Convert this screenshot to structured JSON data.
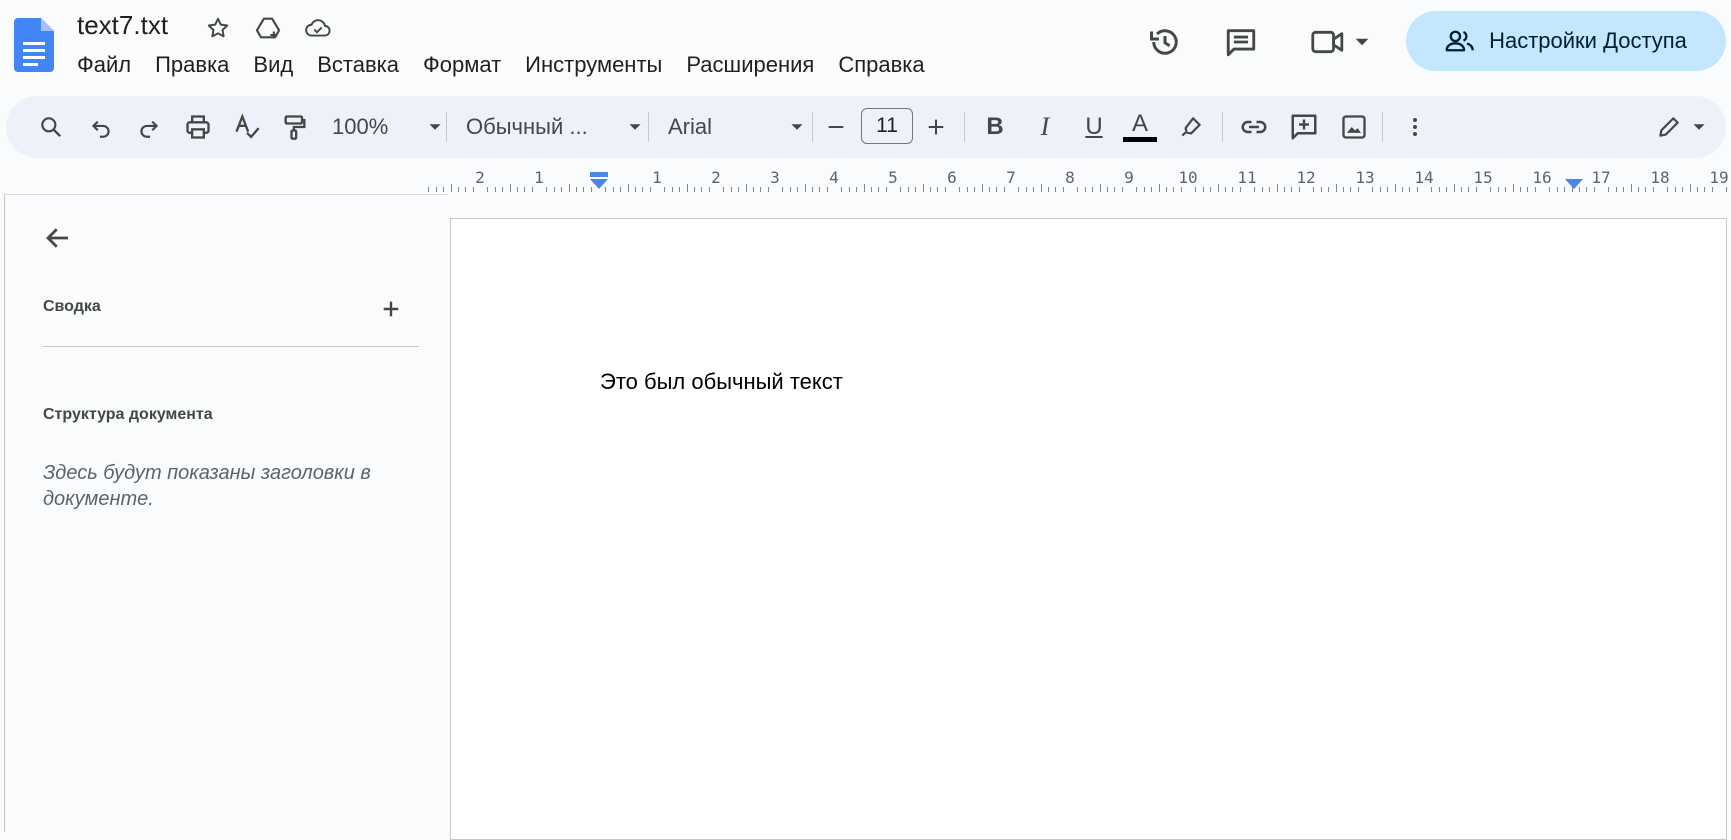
{
  "header": {
    "title": "text7.txt",
    "menu": [
      "Файл",
      "Правка",
      "Вид",
      "Вставка",
      "Формат",
      "Инструменты",
      "Расширения",
      "Справка"
    ],
    "share_label": "Настройки Доступа",
    "icons": {
      "logo": "google-docs-logo",
      "star": "star-icon",
      "move": "move-to-drive-icon",
      "cloud": "cloud-saved-icon",
      "history": "history-icon",
      "comments": "comments-icon",
      "meet": "video-camera-icon",
      "share": "people-icon"
    }
  },
  "toolbar": {
    "zoom": "100%",
    "style": "Обычный ...",
    "font": "Arial",
    "font_size": "11",
    "text_color": "#000000"
  },
  "ruler": {
    "left_numbers": [
      "2",
      "1"
    ],
    "right_numbers": [
      "1",
      "2",
      "3",
      "4",
      "5",
      "6",
      "7",
      "8",
      "9",
      "10",
      "11",
      "12",
      "13",
      "14",
      "15",
      "16",
      "17",
      "18",
      "19"
    ]
  },
  "sidebar": {
    "summary_label": "Сводка",
    "outline_label": "Структура документа",
    "outline_placeholder": "Здесь будут показаны заголовки в документе."
  },
  "document": {
    "text": "Это был обычный текст"
  },
  "colors": {
    "accent": "#1a73e8",
    "share_bg": "#c2e7ff",
    "toolbar_bg": "#edf2fa"
  }
}
